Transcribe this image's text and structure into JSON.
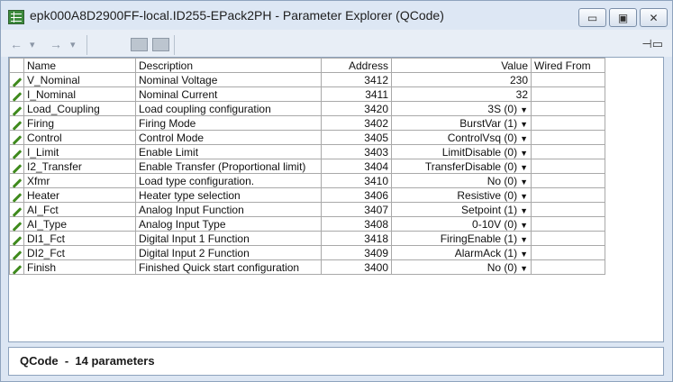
{
  "window": {
    "title": "epk000A8D2900FF-local.ID255-EPack2PH - Parameter Explorer (QCode)"
  },
  "titlebar_buttons": {
    "minimize": "▭",
    "maximize": "▣",
    "close": "✕"
  },
  "toolbar": {
    "back": "←",
    "back_dropdown": "▾",
    "forward": "→",
    "forward_dropdown": "▾",
    "pin": "⊣▭"
  },
  "table": {
    "headers": {
      "name": "Name",
      "description": "Description",
      "address": "Address",
      "value": "Value",
      "wired_from": "Wired From"
    },
    "rows": [
      {
        "name": "V_Nominal",
        "description": "Nominal Voltage",
        "address": "3412",
        "value": "230",
        "dropdown": false,
        "wired_from": ""
      },
      {
        "name": "I_Nominal",
        "description": "Nominal Current",
        "address": "3411",
        "value": "32",
        "dropdown": false,
        "wired_from": ""
      },
      {
        "name": "Load_Coupling",
        "description": "Load coupling configuration",
        "address": "3420",
        "value": "3S (0)",
        "dropdown": true,
        "wired_from": ""
      },
      {
        "name": "Firing",
        "description": "Firing Mode",
        "address": "3402",
        "value": "BurstVar (1)",
        "dropdown": true,
        "wired_from": ""
      },
      {
        "name": "Control",
        "description": "Control Mode",
        "address": "3405",
        "value": "ControlVsq (0)",
        "dropdown": true,
        "wired_from": ""
      },
      {
        "name": "I_Limit",
        "description": "Enable Limit",
        "address": "3403",
        "value": "LimitDisable (0)",
        "dropdown": true,
        "wired_from": ""
      },
      {
        "name": "I2_Transfer",
        "description": "Enable Transfer (Proportional limit)",
        "address": "3404",
        "value": "TransferDisable (0)",
        "dropdown": true,
        "wired_from": ""
      },
      {
        "name": "Xfmr",
        "description": "Load type configuration.",
        "address": "3410",
        "value": "No (0)",
        "dropdown": true,
        "wired_from": ""
      },
      {
        "name": "Heater",
        "description": "Heater type selection",
        "address": "3406",
        "value": "Resistive (0)",
        "dropdown": true,
        "wired_from": ""
      },
      {
        "name": "AI_Fct",
        "description": "Analog Input Function",
        "address": "3407",
        "value": "Setpoint (1)",
        "dropdown": true,
        "wired_from": ""
      },
      {
        "name": "AI_Type",
        "description": "Analog Input Type",
        "address": "3408",
        "value": "0-10V (0)",
        "dropdown": true,
        "wired_from": ""
      },
      {
        "name": "DI1_Fct",
        "description": "Digital Input 1 Function",
        "address": "3418",
        "value": "FiringEnable (1)",
        "dropdown": true,
        "wired_from": ""
      },
      {
        "name": "DI2_Fct",
        "description": "Digital Input 2 Function",
        "address": "3409",
        "value": "AlarmAck (1)",
        "dropdown": true,
        "wired_from": ""
      },
      {
        "name": "Finish",
        "description": "Finished Quick start configuration",
        "address": "3400",
        "value": "No (0)",
        "dropdown": true,
        "wired_from": ""
      }
    ]
  },
  "status": {
    "text": "QCode  -  14 parameters"
  },
  "colors": {
    "titlebar": "#dde7f4",
    "pencil": "#3f8a1d",
    "border": "#8ea3bd",
    "app_icon": "#3c8a3c"
  }
}
